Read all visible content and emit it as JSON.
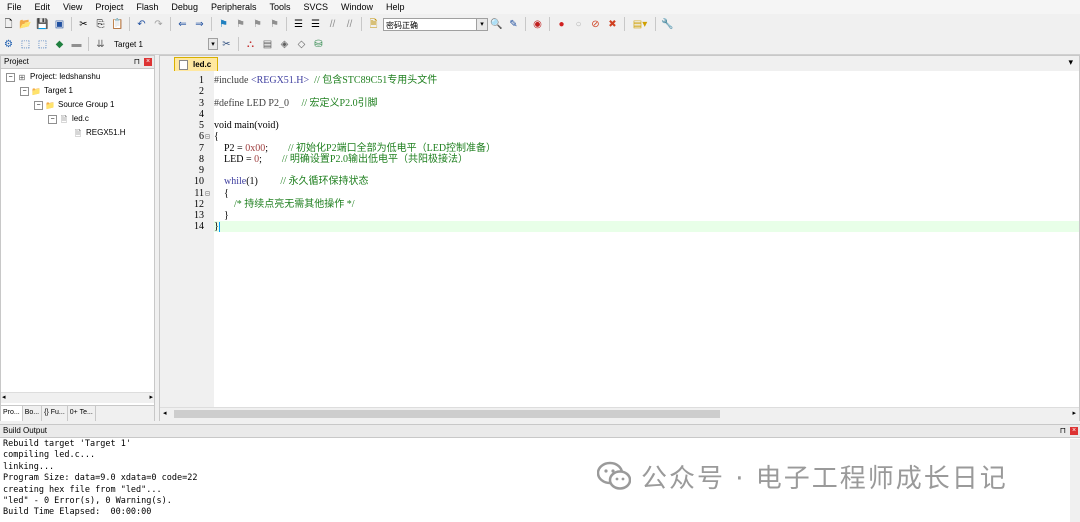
{
  "menu": [
    "File",
    "Edit",
    "View",
    "Project",
    "Flash",
    "Debug",
    "Peripherals",
    "Tools",
    "SVCS",
    "Window",
    "Help"
  ],
  "toolbar": {
    "find_text": "密码正确",
    "target": "Target 1"
  },
  "project_panel": {
    "title": "Project",
    "tree": [
      {
        "label": "Project: ledshanshu",
        "level": 0,
        "expander": "−",
        "icon": "project-icon"
      },
      {
        "label": "Target 1",
        "level": 1,
        "expander": "−",
        "icon": "target-icon"
      },
      {
        "label": "Source Group 1",
        "level": 2,
        "expander": "−",
        "icon": "folder-icon"
      },
      {
        "label": "led.c",
        "level": 3,
        "expander": "−",
        "icon": "file-icon"
      },
      {
        "label": "REGX51.H",
        "level": 4,
        "expander": "",
        "icon": "header-file-icon"
      }
    ],
    "tabs": [
      "Pro...",
      "Bo...",
      "{} Fu...",
      "0+ Te..."
    ]
  },
  "editor": {
    "tab": "led.c",
    "lines": [
      {
        "n": "1",
        "fold": "",
        "segs": [
          [
            "pp",
            "#include "
          ],
          [
            "kw",
            "<REGX51.H>"
          ],
          [
            "",
            "  "
          ],
          [
            "cm",
            "// 包含STC89C51专用头文件"
          ]
        ]
      },
      {
        "n": "2",
        "fold": "",
        "segs": []
      },
      {
        "n": "3",
        "fold": "",
        "segs": [
          [
            "pp",
            "#define LED P2_0"
          ],
          [
            "",
            "     "
          ],
          [
            "cm",
            "// 宏定义P2.0引脚"
          ]
        ]
      },
      {
        "n": "4",
        "fold": "",
        "segs": []
      },
      {
        "n": "5",
        "fold": "",
        "segs": [
          [
            "",
            "void main(void)"
          ]
        ]
      },
      {
        "n": "6",
        "fold": "⊟",
        "segs": [
          [
            "",
            "{"
          ]
        ]
      },
      {
        "n": "7",
        "fold": "",
        "segs": [
          [
            "",
            "    P2 = "
          ],
          [
            "num",
            "0x00"
          ],
          [
            "",
            "; "
          ],
          [
            "",
            "       "
          ],
          [
            "cm",
            "// 初始化P2端口全部为低电平（LED控制准备）"
          ]
        ]
      },
      {
        "n": "8",
        "fold": "",
        "segs": [
          [
            "",
            "    LED = "
          ],
          [
            "num",
            "0"
          ],
          [
            "",
            ";        "
          ],
          [
            "cm",
            "// 明确设置P2.0输出低电平（共阳极接法）"
          ]
        ]
      },
      {
        "n": "9",
        "fold": "",
        "segs": []
      },
      {
        "n": "10",
        "fold": "",
        "segs": [
          [
            "kw",
            "    while"
          ],
          [
            "",
            "(1)         "
          ],
          [
            "cm",
            "// 永久循环保持状态"
          ]
        ]
      },
      {
        "n": "11",
        "fold": "⊟",
        "segs": [
          [
            "",
            "    {"
          ]
        ]
      },
      {
        "n": "12",
        "fold": "",
        "segs": [
          [
            "cm",
            "        /* 持续点亮无需其他操作 */"
          ]
        ]
      },
      {
        "n": "13",
        "fold": "",
        "segs": [
          [
            "",
            "    }"
          ]
        ]
      },
      {
        "n": "14",
        "fold": "",
        "segs": [
          [
            "",
            "}"
          ]
        ],
        "current": true
      }
    ]
  },
  "build_output": {
    "title": "Build Output",
    "lines": [
      "Rebuild target 'Target 1'",
      "compiling led.c...",
      "linking...",
      "Program Size: data=9.0 xdata=0 code=22",
      "creating hex file from \"led\"...",
      "\"led\" - 0 Error(s), 0 Warning(s).",
      "Build Time Elapsed:  00:00:00"
    ]
  },
  "watermark": "公众号 · 电子工程师成长日记"
}
